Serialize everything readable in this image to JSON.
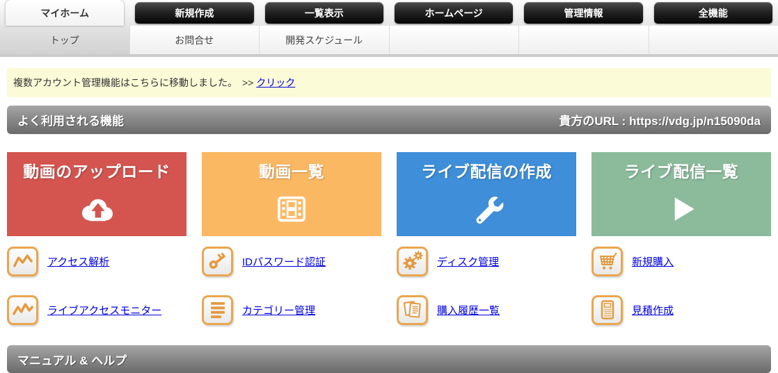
{
  "nav": {
    "tabs": [
      {
        "label": "マイホーム",
        "active": true
      },
      {
        "label": "新規作成",
        "active": false
      },
      {
        "label": "一覧表示",
        "active": false
      },
      {
        "label": "ホームページ",
        "active": false
      },
      {
        "label": "管理情報",
        "active": false
      },
      {
        "label": "全機能",
        "active": false
      }
    ],
    "subtabs": [
      {
        "label": "トップ",
        "selected": true
      },
      {
        "label": "お問合せ",
        "selected": false
      },
      {
        "label": "開発スケジュール",
        "selected": false
      },
      {
        "label": "",
        "selected": false
      },
      {
        "label": "",
        "selected": false
      },
      {
        "label": "",
        "selected": false
      }
    ]
  },
  "notice": {
    "text": "複数アカウント管理機能はこちらに移動しました。　>> ",
    "link_label": "クリック"
  },
  "sections": {
    "frequent": {
      "title": "よく利用される機能",
      "your_url": "貴方のURL : https://vdg.jp/n15090da"
    },
    "manual": {
      "title": "マニュアル & ヘルプ"
    }
  },
  "tiles": [
    {
      "label": "動画のアップロード",
      "color": "#d4554f",
      "icon": "cloud-upload-icon"
    },
    {
      "label": "動画一覧",
      "color": "#fbb863",
      "icon": "film-icon"
    },
    {
      "label": "ライブ配信の作成",
      "color": "#3e8ed9",
      "icon": "wrench-icon"
    },
    {
      "label": "ライブ配信一覧",
      "color": "#8cbb9c",
      "icon": "play-icon"
    }
  ],
  "quick_links": [
    {
      "label": "アクセス解析",
      "icon": "line-chart-icon"
    },
    {
      "label": "IDパスワード認証",
      "icon": "key-icon"
    },
    {
      "label": "ディスク管理",
      "icon": "gears-icon"
    },
    {
      "label": "新規購入",
      "icon": "cart-icon"
    },
    {
      "label": "ライブアクセスモニター",
      "icon": "live-chart-icon"
    },
    {
      "label": "カテゴリー管理",
      "icon": "list-icon"
    },
    {
      "label": "購入履歴一覧",
      "icon": "documents-icon"
    },
    {
      "label": "見積作成",
      "icon": "calculator-icon"
    }
  ],
  "colors": {
    "accent_orange": "#eaa64f",
    "link_blue": "#0000e0",
    "notice_bg": "#fbfbd8",
    "tab_black": "#1a1a1a",
    "section_gray": "#8a8a8a"
  }
}
